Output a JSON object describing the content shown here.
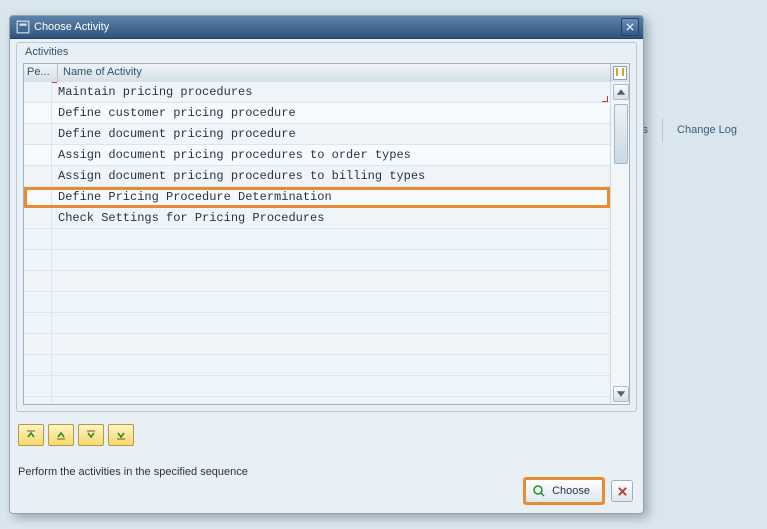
{
  "dialog": {
    "title": "Choose Activity",
    "group_caption": "Activities",
    "col_pe": "Pe...",
    "col_name": "Name of Activity",
    "footer_hint": "Perform the activities in the specified sequence",
    "choose_label": "Choose",
    "rows": [
      "Maintain pricing procedures",
      "Define customer pricing procedure",
      "Define document pricing procedure",
      "Assign document pricing procedures to order types",
      "Assign document pricing procedures to billing types",
      "Define Pricing Procedure Determination",
      "Check Settings for Pricing Procedures"
    ]
  },
  "background": {
    "link_notes": "e Notes",
    "link_changelog": "Change Log"
  }
}
